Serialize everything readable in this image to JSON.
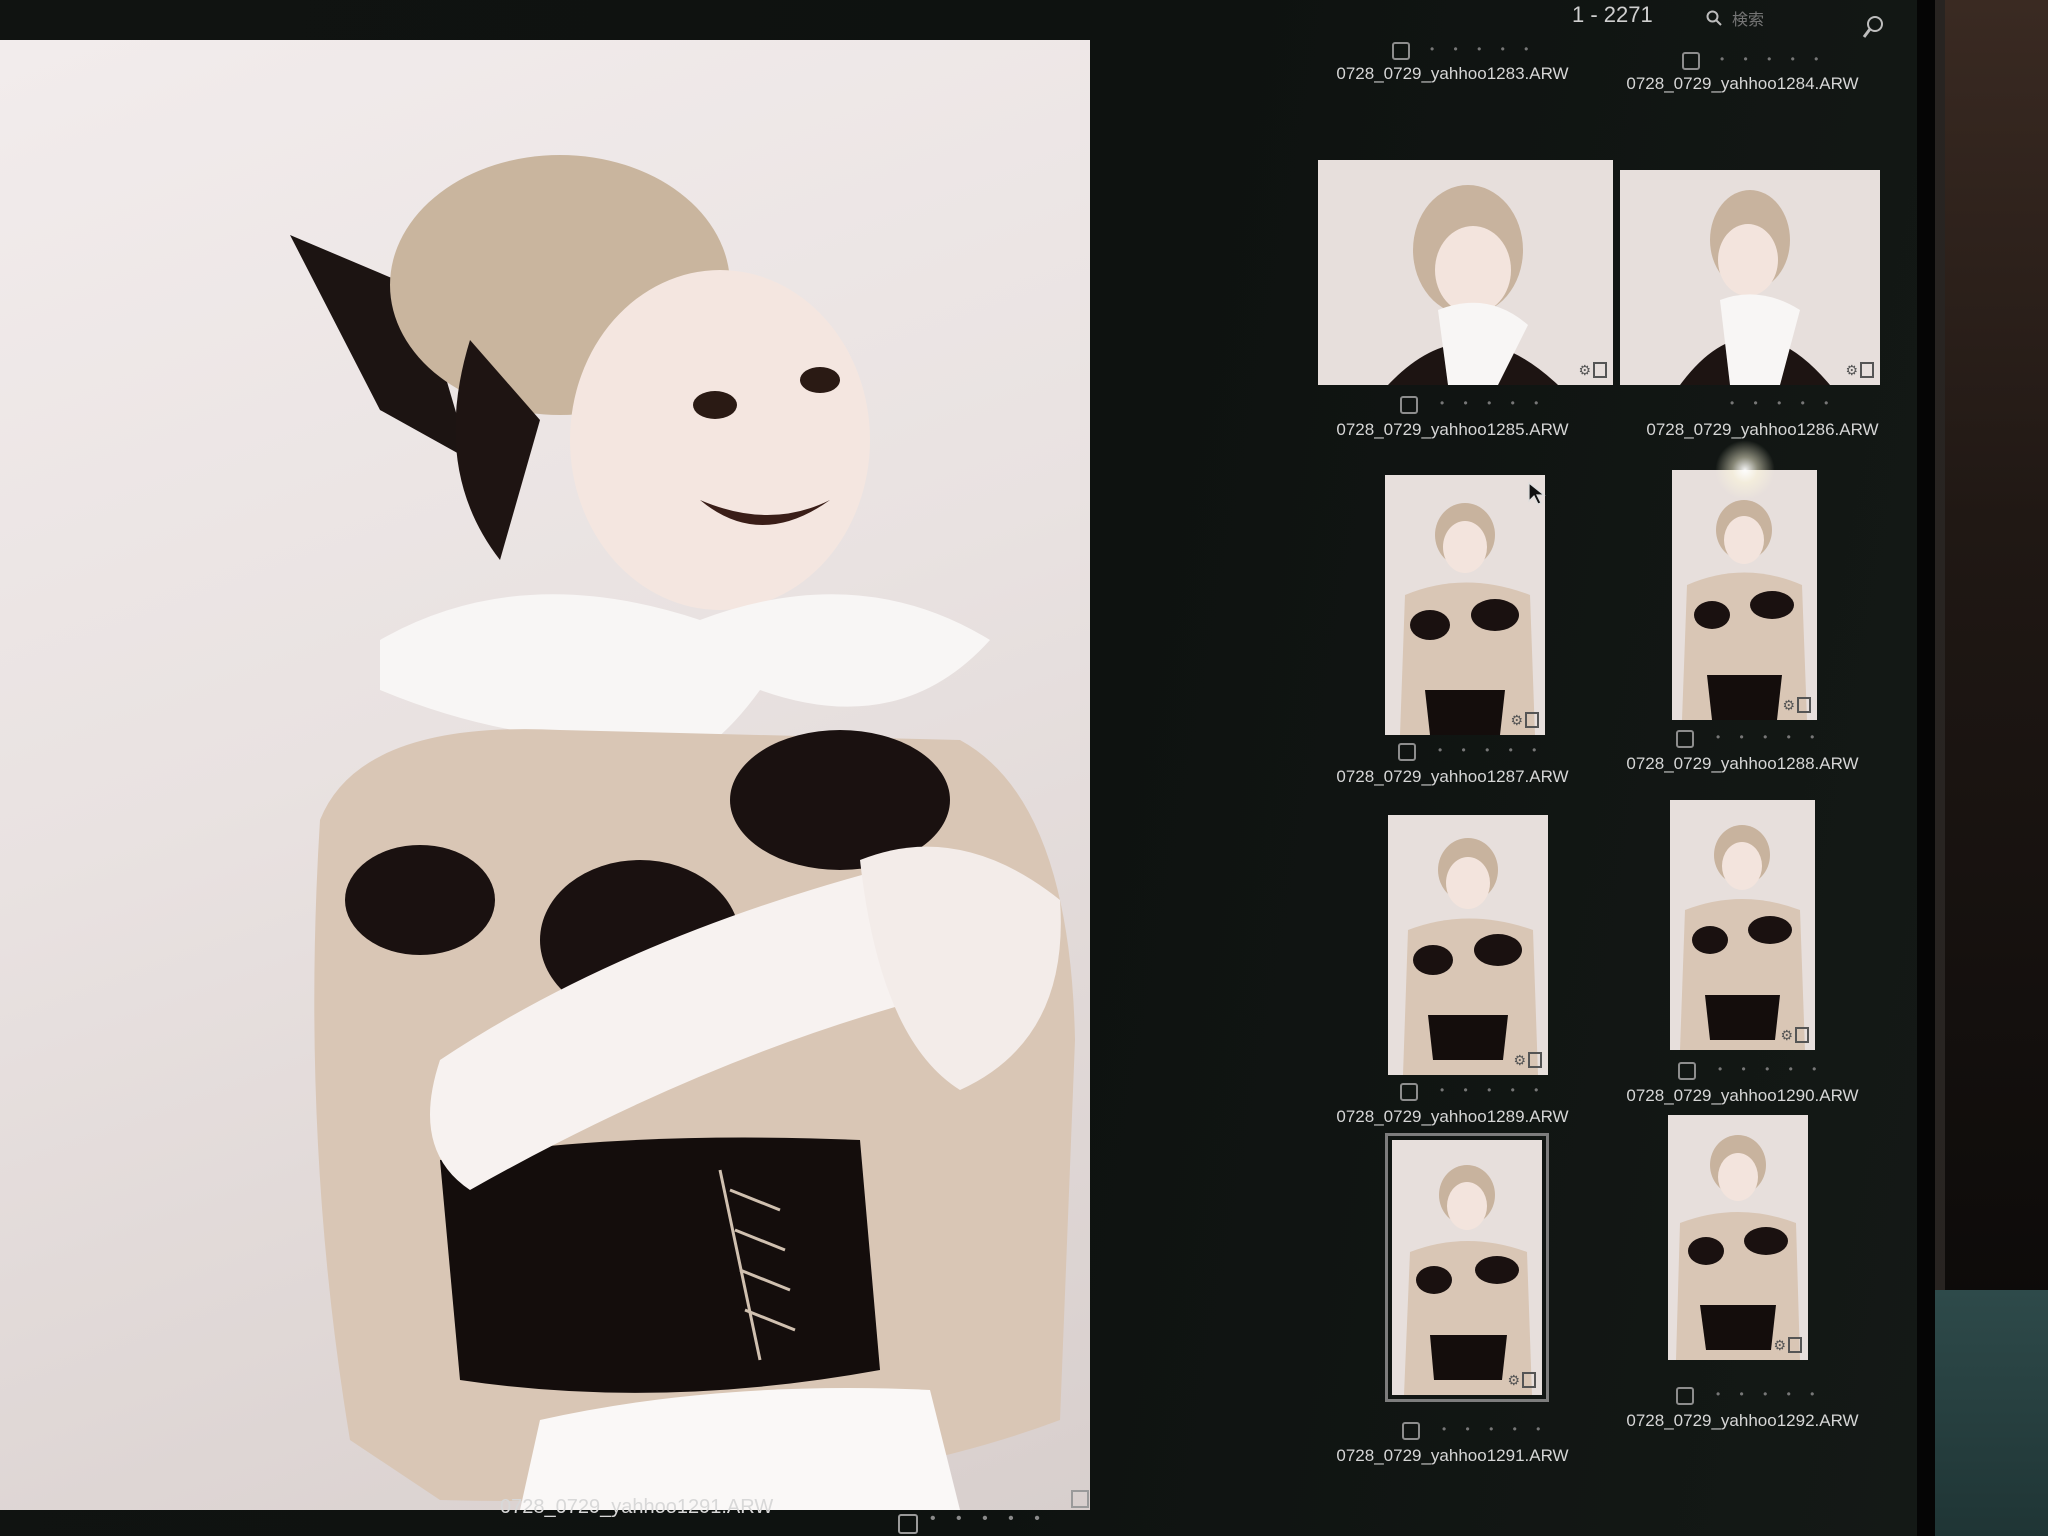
{
  "toolbar": {
    "count": "1 - 2271",
    "search_placeholder": "検索"
  },
  "preview": {
    "file_name": "0728_0729_yahhoo1291.ARW",
    "rating_dots": "• • • • •"
  },
  "thumbnails": [
    {
      "file_name": "0728_0729_yahhoo1283.ARW",
      "rating_dots": "• • • • •"
    },
    {
      "file_name": "0728_0729_yahhoo1284.ARW",
      "rating_dots": "• • • • •"
    },
    {
      "file_name": "0728_0729_yahhoo1285.ARW",
      "rating_dots": "• • • • •"
    },
    {
      "file_name": "0728_0729_yahhoo1286.ARW",
      "rating_dots": "• • • • •"
    },
    {
      "file_name": "0728_0729_yahhoo1287.ARW",
      "rating_dots": "• • • • •"
    },
    {
      "file_name": "0728_0729_yahhoo1288.ARW",
      "rating_dots": "• • • • •"
    },
    {
      "file_name": "0728_0729_yahhoo1289.ARW",
      "rating_dots": "• • • • •"
    },
    {
      "file_name": "0728_0729_yahhoo1290.ARW",
      "rating_dots": "• • • • •"
    },
    {
      "file_name": "0728_0729_yahhoo1291.ARW",
      "rating_dots": "• • • • •"
    },
    {
      "file_name": "0728_0729_yahhoo1292.ARW",
      "rating_dots": "• • • • •"
    }
  ],
  "icons": {
    "search": "search-icon",
    "zoom": "magnifier-icon",
    "gear": "gear-icon",
    "cursor": "pointer-cursor-icon"
  },
  "colors": {
    "screen_bg": "#0e1210",
    "photo_bg": "#ece6e5",
    "text": "#d6d6d6"
  }
}
